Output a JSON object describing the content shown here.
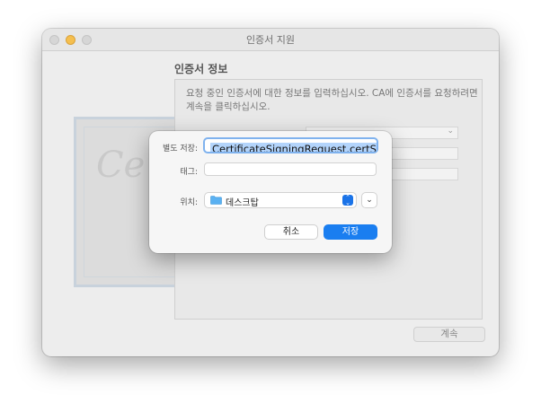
{
  "window": {
    "title": "인증서 지원",
    "heading": "인증서 정보",
    "description": "요청 중인 인증서에 대한 정보를 입력하십시오. CA에 인증서를 요청하려면 계속을 클릭하십시오.",
    "continue_label": "계속"
  },
  "dialog": {
    "save_as_label": "별도 저장:",
    "save_as_value": "CertificateSigningRequest.certSign",
    "tags_label": "태그:",
    "tags_value": "",
    "where_label": "위치:",
    "where_value": "데스크탑",
    "cancel_label": "취소",
    "save_label": "저장"
  },
  "icons": {
    "folder": "folder-icon",
    "stepper": "up-down-chevron-icon",
    "expand": "chevron-down-icon"
  },
  "colors": {
    "accent": "#1a7ef0",
    "traffic_minimize": "#f5bf4f"
  }
}
